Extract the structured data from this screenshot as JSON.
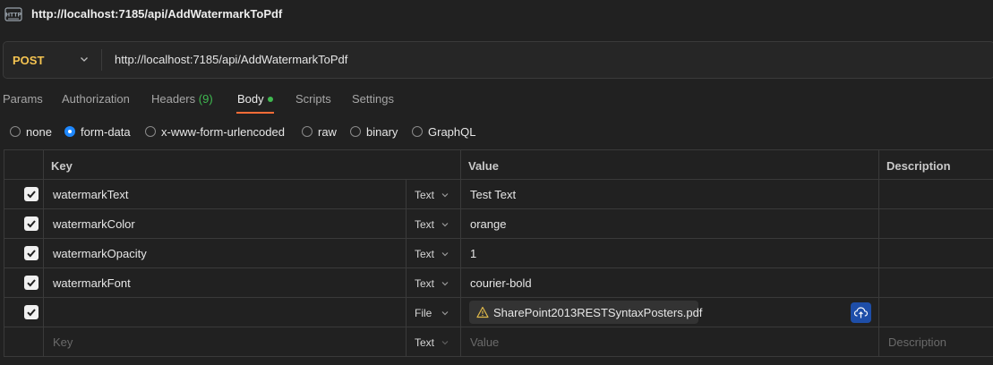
{
  "title": "http://localhost:7185/api/AddWatermarkToPdf",
  "request": {
    "method": "POST",
    "url": "http://localhost:7185/api/AddWatermarkToPdf"
  },
  "tabs": [
    {
      "label": "Params"
    },
    {
      "label": "Authorization"
    },
    {
      "label": "Headers",
      "count": "(9)"
    },
    {
      "label": "Body",
      "active": true
    },
    {
      "label": "Scripts"
    },
    {
      "label": "Settings"
    }
  ],
  "body_types": [
    {
      "label": "none",
      "checked": false
    },
    {
      "label": "form-data",
      "checked": true
    },
    {
      "label": "x-www-form-urlencoded",
      "checked": false
    },
    {
      "label": "raw",
      "checked": false
    },
    {
      "label": "binary",
      "checked": false
    },
    {
      "label": "GraphQL",
      "checked": false
    }
  ],
  "table": {
    "headers": {
      "key": "Key",
      "value": "Value",
      "description": "Description"
    },
    "rows": [
      {
        "key": "watermarkText",
        "type": "Text",
        "value": "Test Text",
        "checked": true
      },
      {
        "key": "watermarkColor",
        "type": "Text",
        "value": "orange",
        "checked": true
      },
      {
        "key": "watermarkOpacity",
        "type": "Text",
        "value": "1",
        "checked": true
      },
      {
        "key": "watermarkFont",
        "type": "Text",
        "value": "courier-bold",
        "checked": true
      },
      {
        "key": "",
        "type": "File",
        "value": "SharePoint2013RESTSyntaxPosters.pdf",
        "checked": true
      }
    ],
    "empty_row": {
      "key": "Key",
      "type": "Text",
      "value": "Value",
      "description": "Description"
    }
  },
  "colors": {
    "method": "#f5c451",
    "active_tab_underline": "#ff6c37",
    "status_dot": "#3fb950",
    "radio_checked": "#1e88ff",
    "upload_button": "#1e4ea8"
  },
  "icons": {
    "app": "http-icon",
    "method_dropdown": "chevron-down-icon",
    "file_warning": "warning-icon",
    "upload": "cloud-upload-icon"
  }
}
